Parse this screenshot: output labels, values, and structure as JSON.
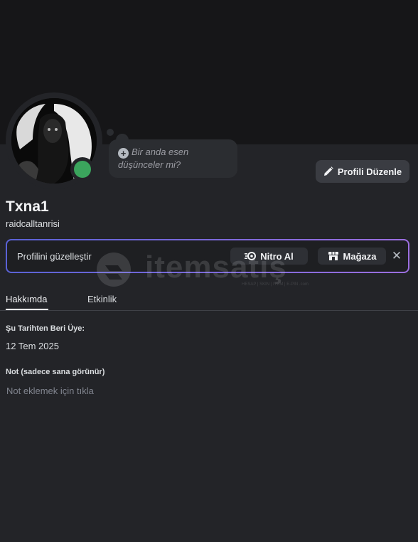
{
  "profile": {
    "display_name": "Txna1",
    "username": "raidcalltanrisi",
    "status": "online",
    "status_color": "#3ba55d"
  },
  "thought_bubble": {
    "line1": "Bir anda esen",
    "line2": "düşünceler mi?",
    "icon": "add-circle-icon"
  },
  "actions": {
    "edit_profile_label": "Profili Düzenle",
    "edit_icon": "pencil-icon"
  },
  "nitro_banner": {
    "text": "Profilini güzelleştir",
    "nitro_button_label": "Nitro Al",
    "nitro_icon": "nitro-icon",
    "shop_button_label": "Mağaza",
    "shop_icon": "shop-icon",
    "close_label": "✕",
    "gradient_start": "#5a62d6",
    "gradient_end": "#9c6fe0"
  },
  "watermark": {
    "text": "itemsatış",
    "sub": "HESAP | SKIN | ITEM | E-PIN",
    "domain": ".com"
  },
  "tabs": [
    {
      "label": "Hakkımda",
      "active": true
    },
    {
      "label": "Etkinlik",
      "active": false
    }
  ],
  "about": {
    "member_since_label": "Şu Tarihten Beri Üye:",
    "member_since_value": "12 Tem 2025",
    "note_label": "Not (sadece sana görünür)",
    "note_placeholder": "Not eklemek için tıkla"
  }
}
